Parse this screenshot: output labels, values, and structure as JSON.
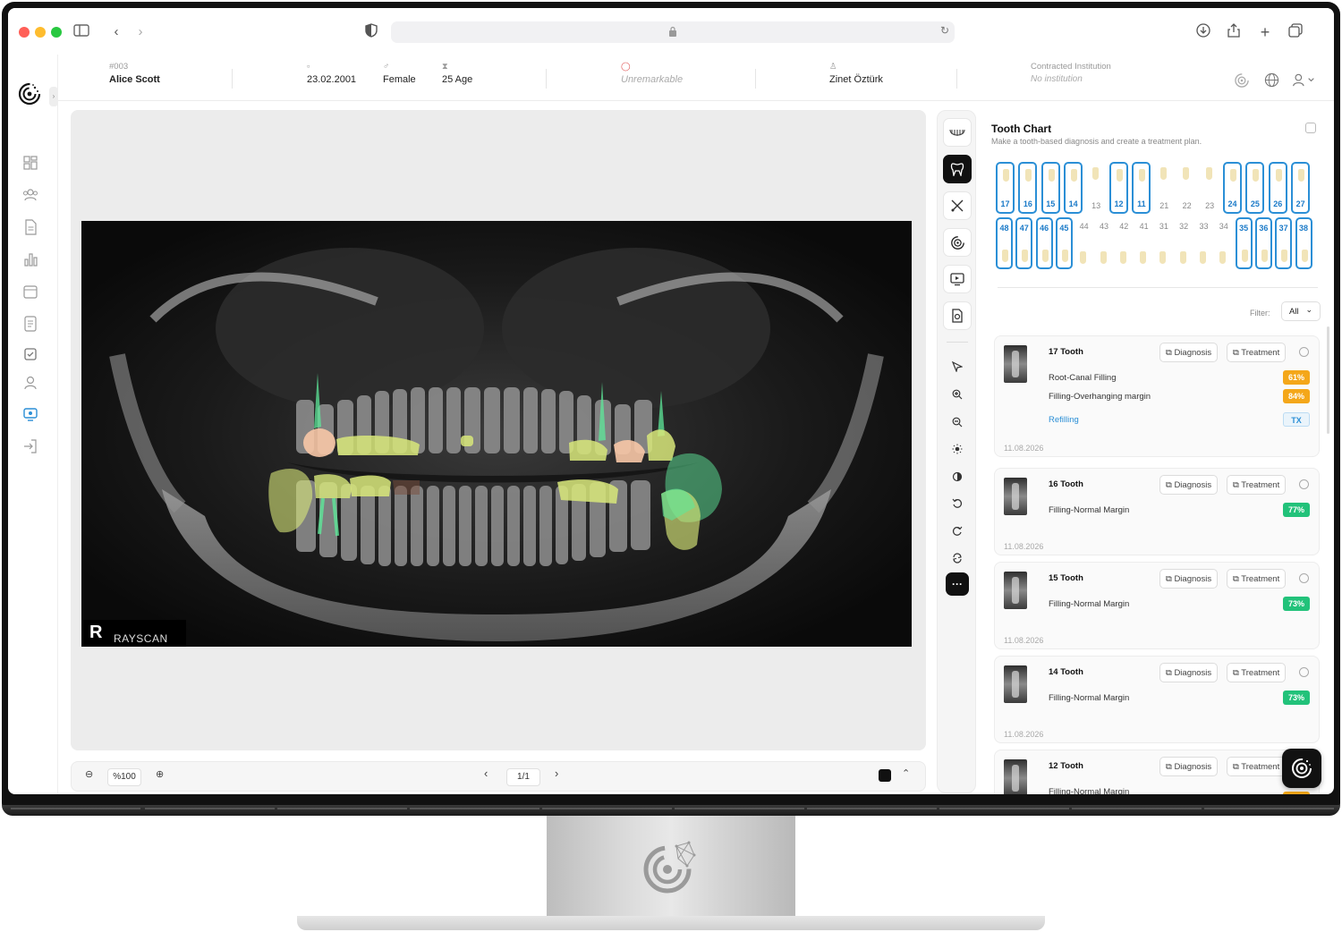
{
  "patient": {
    "id": "#003",
    "name": "Alice Scott",
    "birthdate": "23.02.2001",
    "gender": "Female",
    "age": "25 Age",
    "condition": "Unremarkable",
    "doctor": "Zinet Öztürk",
    "institution_label": "Contracted Institution",
    "institution_value": "No institution"
  },
  "viewer": {
    "zoom": "%100",
    "page": "1/1",
    "watermark_letter": "R",
    "watermark_text": "RAYSCAN"
  },
  "tooth_chart": {
    "title": "Tooth Chart",
    "subtitle": "Make a tooth-based diagnosis and create a treatment plan.",
    "upper": [
      {
        "n": "17",
        "hl": true
      },
      {
        "n": "16",
        "hl": true
      },
      {
        "n": "15",
        "hl": true
      },
      {
        "n": "14",
        "hl": true
      },
      {
        "n": "13",
        "hl": false
      },
      {
        "n": "12",
        "hl": true
      },
      {
        "n": "11",
        "hl": true
      },
      {
        "n": "21",
        "hl": false
      },
      {
        "n": "22",
        "hl": false
      },
      {
        "n": "23",
        "hl": false
      },
      {
        "n": "24",
        "hl": true
      },
      {
        "n": "25",
        "hl": true
      },
      {
        "n": "26",
        "hl": true
      },
      {
        "n": "27",
        "hl": true
      }
    ],
    "lower": [
      {
        "n": "48",
        "hl": true
      },
      {
        "n": "47",
        "hl": true
      },
      {
        "n": "46",
        "hl": true
      },
      {
        "n": "45",
        "hl": true
      },
      {
        "n": "44",
        "hl": false
      },
      {
        "n": "43",
        "hl": false
      },
      {
        "n": "42",
        "hl": false
      },
      {
        "n": "41",
        "hl": false
      },
      {
        "n": "31",
        "hl": false
      },
      {
        "n": "32",
        "hl": false
      },
      {
        "n": "33",
        "hl": false
      },
      {
        "n": "34",
        "hl": false
      },
      {
        "n": "35",
        "hl": true
      },
      {
        "n": "36",
        "hl": true
      },
      {
        "n": "37",
        "hl": true
      },
      {
        "n": "38",
        "hl": true
      }
    ],
    "filter_label": "Filter:",
    "filter_value": "All"
  },
  "buttons": {
    "diagnosis": "Diagnosis",
    "treatment": "Treatment"
  },
  "findings": [
    {
      "title": "17 Tooth",
      "rows": [
        {
          "text": "Root-Canal Filling",
          "badge": "61%",
          "color": "orange",
          "link": false
        },
        {
          "text": "Filling-Overhanging margin",
          "badge": "84%",
          "color": "orange",
          "link": false
        },
        {
          "text": "Refilling",
          "badge": "TX",
          "color": "tx",
          "link": true
        }
      ],
      "date": "11.08.2026"
    },
    {
      "title": "16 Tooth",
      "rows": [
        {
          "text": "Filling-Normal Margin",
          "badge": "77%",
          "color": "green",
          "link": false
        }
      ],
      "date": "11.08.2026"
    },
    {
      "title": "15 Tooth",
      "rows": [
        {
          "text": "Filling-Normal Margin",
          "badge": "73%",
          "color": "green",
          "link": false
        }
      ],
      "date": "11.08.2026"
    },
    {
      "title": "14 Tooth",
      "rows": [
        {
          "text": "Filling-Normal Margin",
          "badge": "73%",
          "color": "green",
          "link": false
        }
      ],
      "date": "11.08.2026"
    },
    {
      "title": "12 Tooth",
      "rows": [
        {
          "text": "Filling-Normal Margin",
          "badge": "",
          "color": "orange",
          "link": false
        }
      ],
      "date": ""
    }
  ],
  "colors": {
    "accent": "#2b8fd6",
    "orange_badge": "#f4a71a",
    "green_badge": "#22c27a",
    "mask_yellow": "#d8e87a",
    "mask_green": "#5ee89a",
    "mask_peach": "#f7c7a6"
  }
}
